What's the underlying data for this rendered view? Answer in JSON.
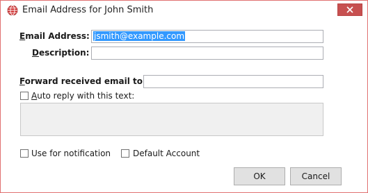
{
  "window": {
    "title": "Email Address for John Smith"
  },
  "form": {
    "email_label_accel": "E",
    "email_label_rest": "mail Address:",
    "email_value": "jsmith@example.com",
    "description_label_accel": "D",
    "description_label_rest": "escription:",
    "description_value": "",
    "forward_label_accel": "F",
    "forward_label_rest": "orward received email to",
    "forward_value": "",
    "auto_reply_label_accel": "A",
    "auto_reply_label_rest": "uto reply with this text:",
    "auto_reply_checked": false,
    "auto_reply_text": "",
    "notification_label": "Use for notification",
    "notification_checked": false,
    "default_account_label": "Default Account",
    "default_account_checked": false
  },
  "buttons": {
    "ok_label": "OK",
    "cancel_label": "Cancel"
  },
  "icons": {
    "app_icon": "globe-icon",
    "close_icon": "close-icon"
  },
  "colors": {
    "close_button": "#c75050",
    "selection": "#3399ff",
    "window_border": "#e07070"
  }
}
